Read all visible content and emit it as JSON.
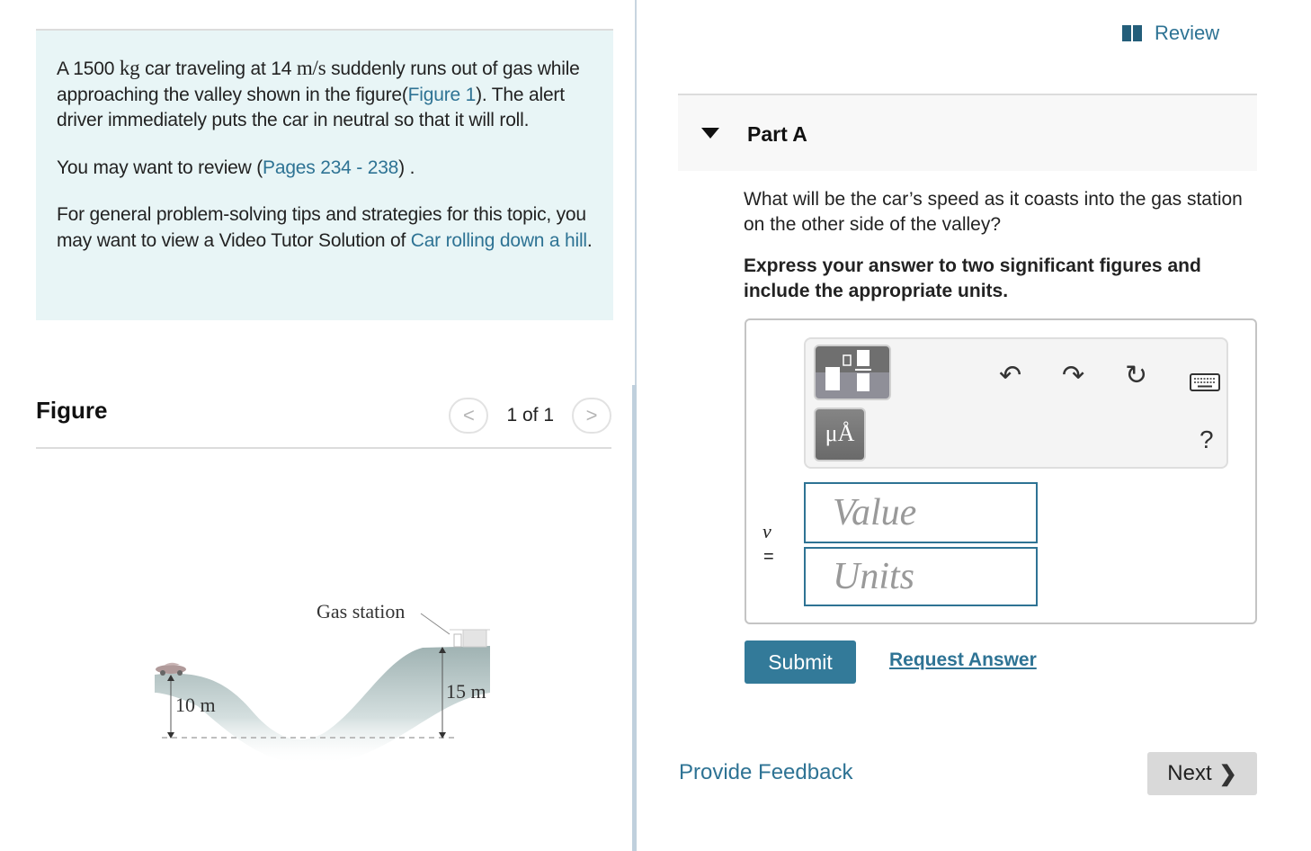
{
  "problem": {
    "intro_a": "A 1500 ",
    "unit_kg": "kg",
    "intro_b": " car traveling at 14 ",
    "unit_ms": "m/s",
    "intro_c": " suddenly runs out of gas while approaching the valley shown in the figure(",
    "figure_link": "Figure 1",
    "intro_d": "). The alert driver immediately puts the car in neutral so that it will roll.",
    "review_a": "You may want to review (",
    "pages_link": "Pages 234 - 238",
    "review_b": ") .",
    "tips_a": "For general problem-solving tips and strategies for this topic, you may want to view a Video Tutor Solution of ",
    "video_link": "Car rolling down a hill",
    "tips_b": "."
  },
  "figure": {
    "title": "Figure",
    "pager_text": "1 of 1",
    "prev_glyph": "<",
    "next_glyph": ">",
    "labels": {
      "gas_station": "Gas station",
      "left_height": "10 m",
      "right_height": "15 m"
    }
  },
  "review": {
    "label": "Review",
    "icon": "book-icon"
  },
  "part": {
    "title": "Part A",
    "question": "What will be the car’s speed as it coasts into the gas station on the other side of the valley?",
    "instructions": "Express your answer to two significant figures and include the appropriate units."
  },
  "toolbar": {
    "units_glyph": "μÅ",
    "undo_glyph": "↶",
    "redo_glyph": "↷",
    "reset_glyph": "↻",
    "help_glyph": "?",
    "icons": [
      "templates-icon",
      "units-icon",
      "undo-icon",
      "redo-icon",
      "reset-icon",
      "keyboard-icon",
      "help-icon"
    ]
  },
  "answer": {
    "variable": "v",
    "equals": "=",
    "value_placeholder": "Value",
    "units_placeholder": "Units",
    "value": "",
    "units": ""
  },
  "actions": {
    "submit": "Submit",
    "request_answer": "Request Answer",
    "provide_feedback": "Provide Feedback",
    "next": "Next",
    "next_glyph": "❯"
  },
  "colors": {
    "accent": "#2e7394",
    "submit_bg": "#337a99",
    "problem_bg": "#e8f5f6",
    "next_bg": "#d9d9d9"
  }
}
